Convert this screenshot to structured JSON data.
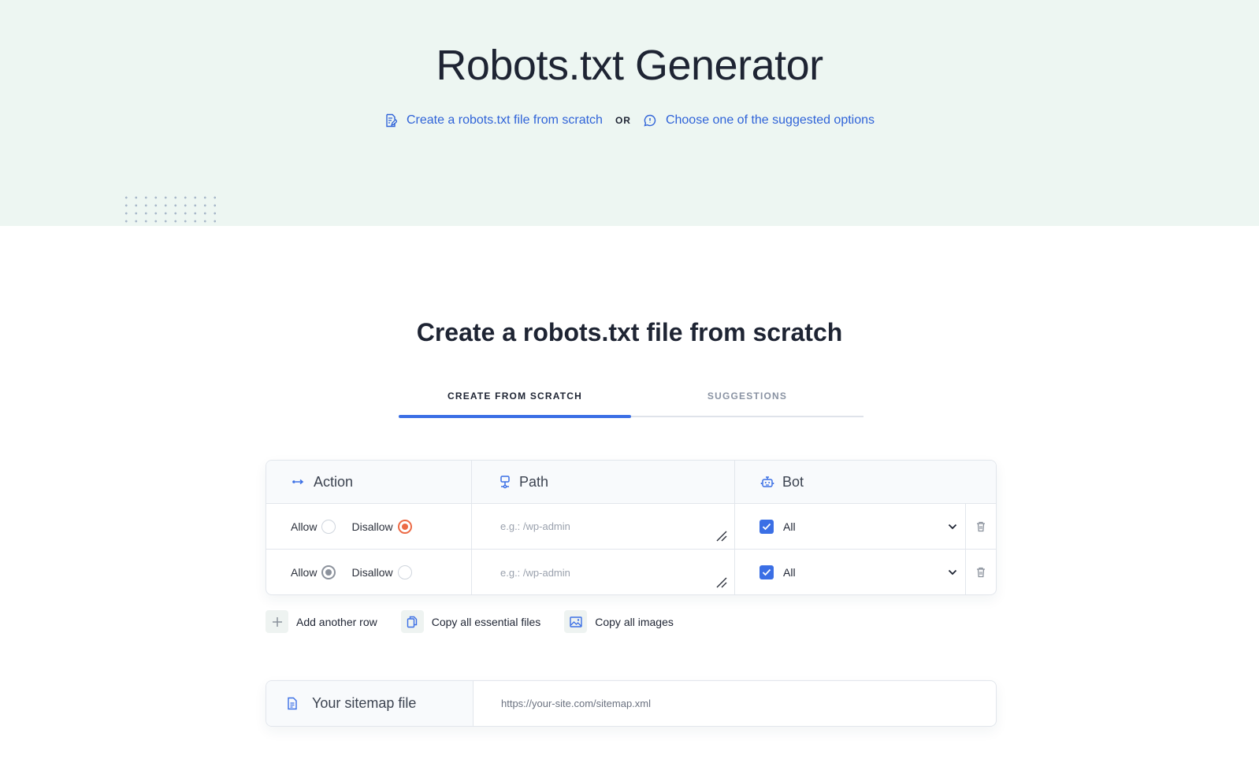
{
  "hero": {
    "title": "Robots.txt Generator",
    "link_scratch": "Create a robots.txt file from scratch",
    "or": "OR",
    "link_suggested": "Choose one of the suggested options"
  },
  "section": {
    "title": "Create a robots.txt file from scratch"
  },
  "tabs": [
    {
      "label": "CREATE FROM SCRATCH",
      "active": true
    },
    {
      "label": "SUGGESTIONS",
      "active": false
    }
  ],
  "table": {
    "headers": {
      "action": "Action",
      "path": "Path",
      "bot": "Bot"
    },
    "rows": [
      {
        "allow_label": "Allow",
        "disallow_label": "Disallow",
        "selected": "Disallow",
        "path_placeholder": "e.g.: /wp-admin",
        "bot_checked": true,
        "bot": "All"
      },
      {
        "allow_label": "Allow",
        "disallow_label": "Disallow",
        "selected": "Allow",
        "path_placeholder": "e.g.: /wp-admin",
        "bot_checked": true,
        "bot": "All"
      }
    ]
  },
  "actions": {
    "add_row": "Add another row",
    "copy_essential": "Copy all essential files",
    "copy_images": "Copy all images"
  },
  "sitemap": {
    "label": "Your sitemap file",
    "placeholder": "https://your-site.com/sitemap.xml"
  },
  "colors": {
    "accent": "#3b6fe5",
    "link": "#2f63d8",
    "radio_selected_disallow": "#ec6a45",
    "hero_bg": "#edf6f2"
  }
}
